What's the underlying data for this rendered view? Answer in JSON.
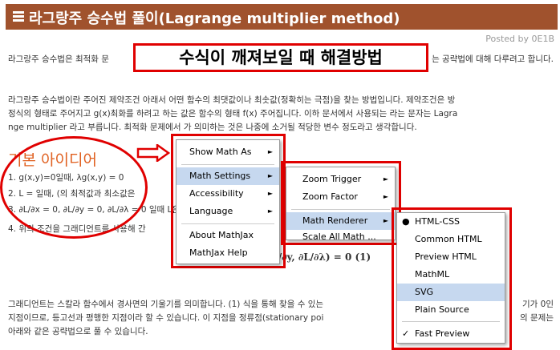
{
  "header": {
    "title": "라그랑주 승수법 풀이(Lagrange multiplier method)"
  },
  "posted_by": "Posted by 0E1B",
  "intro": {
    "line1_left": "라그랑주 승수법은 최적화 문",
    "line1_right": "는 공략법에 대해 다루려고 합니다."
  },
  "callout": "수식이 깨져보일 때 해결방법",
  "para2": [
    "라그랑주 승수법이란 주어진 제약조건 아래서 어떤 함수의 최댓값이나 최솟값(정확히는 극점)을 찾는 방법입니다. 제약조건은 방",
    "정식의 형태로 주어지고 g(x)최화를 하려고 하는 값은 함수의 형태 f(x) 주어집니다. 이하 문서에서 사용되는 라는 문자는 Lagra",
    "nge multiplier 라고 부릅니다. 최적화 문제에서 가 의미하는 것은 나중에 소거될 적당한 변수 정도라고 생각합니다."
  ],
  "heading": "기본 아이디어",
  "steps": [
    "1. g(x,y)=0일때, λg(x,y) = 0",
    "2. L = 일때, (의 최적값과 최소값은",
    "3. ∂L/∂x = 0, ∂L/∂y = 0, ∂L/∂λ = 0 일때 L은 최댓값이",
    "4. 위의 조건을 그래디언트를 사용해 간"
  ],
  "math_tail": "∂L/∂y, ∂L/∂λ) = 0   (1)",
  "para3": [
    "그래디언트는 스칼라 함수에서 경사면의 기울기를 의미합니다. (1) 식을 통해 찾을 수 있는",
    "지점이므로, 등고선과 평행한 지점이라 할 수 있습니다. 이 지점을 정류점(stationary poi",
    "아래와 같은 공략법으로 풀 수 있습니다."
  ],
  "para3_right": [
    "기가 0인",
    "의 문제는",
    ""
  ],
  "context_menu": {
    "items": [
      {
        "label": "Show Math As",
        "submenu": true
      },
      {
        "label": "Math Settings",
        "submenu": true,
        "highlighted": true
      },
      {
        "label": "Accessibility",
        "submenu": true
      },
      {
        "label": "Language",
        "submenu": true
      },
      {
        "label": "About MathJax",
        "submenu": false
      },
      {
        "label": "MathJax Help",
        "submenu": false
      }
    ]
  },
  "settings_menu": {
    "items": [
      {
        "label": "Zoom Trigger",
        "submenu": true
      },
      {
        "label": "Zoom Factor",
        "submenu": true
      },
      {
        "label": "Math Renderer",
        "submenu": true,
        "highlighted": true
      },
      {
        "label": "Scale All Math ...",
        "submenu": false
      }
    ]
  },
  "renderer_menu": {
    "items": [
      {
        "label": "HTML-CSS",
        "selected": true
      },
      {
        "label": "Common HTML"
      },
      {
        "label": "Preview HTML"
      },
      {
        "label": "MathML"
      },
      {
        "label": "SVG",
        "highlighted": true
      },
      {
        "label": "Plain Source"
      },
      {
        "label": "Fast Preview",
        "checked": true
      }
    ]
  },
  "glyphs": {
    "submenu_arrow": "►",
    "radio": "●",
    "check": "✓"
  },
  "colors": {
    "header": "#a0522d",
    "annotation": "#e00000",
    "heading": "#e06020",
    "highlight": "#c6d8ef"
  }
}
